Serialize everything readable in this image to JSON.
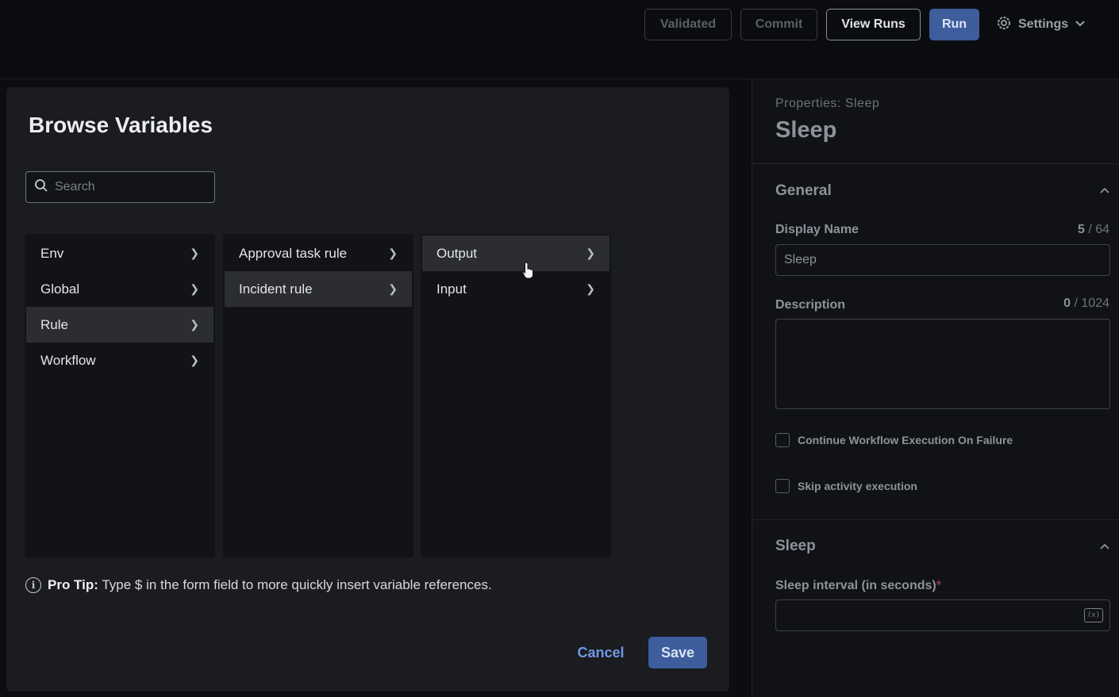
{
  "toolbar": {
    "validated": "Validated",
    "commit": "Commit",
    "view_runs": "View Runs",
    "run": "Run",
    "settings": "Settings"
  },
  "modal": {
    "title": "Browse Variables",
    "search_placeholder": "Search",
    "columns": [
      {
        "items": [
          "Env",
          "Global",
          "Rule",
          "Workflow"
        ],
        "selected": "Rule"
      },
      {
        "items": [
          "Approval task rule",
          "Incident rule"
        ],
        "selected": "Incident rule"
      },
      {
        "items": [
          "Output",
          "Input"
        ],
        "selected": "Output"
      }
    ],
    "pro_tip_label": "Pro Tip:",
    "pro_tip_text": "Type $ in the form field to more quickly insert variable references.",
    "cancel": "Cancel",
    "save": "Save"
  },
  "panel": {
    "subtitle": "Properties: Sleep",
    "title": "Sleep",
    "general": {
      "title": "General",
      "display_name_label": "Display Name",
      "display_name_count": "5",
      "display_name_max": "/ 64",
      "display_name_value": "Sleep",
      "description_label": "Description",
      "description_count": "0",
      "description_max": "/ 1024",
      "continue_label": "Continue Workflow Execution On Failure",
      "skip_label": "Skip activity execution"
    },
    "sleep": {
      "title": "Sleep",
      "interval_label": "Sleep interval (in seconds)",
      "required_mark": "*",
      "variable_icon_text": "(x)"
    }
  },
  "colors": {
    "primary": "#3d5d9c",
    "link": "#6f97e6",
    "background": "#0c0d10",
    "modal": "#1b1c20"
  }
}
